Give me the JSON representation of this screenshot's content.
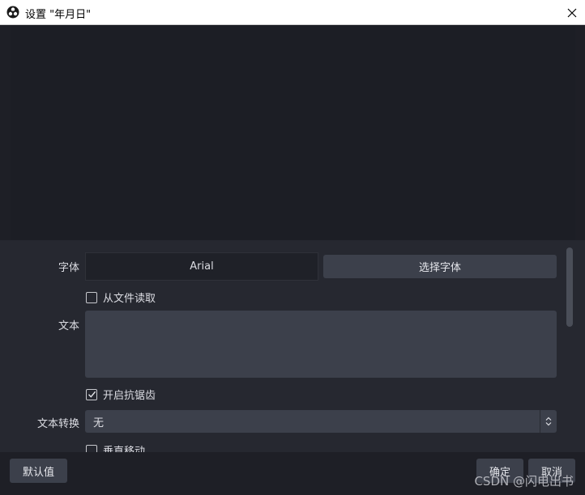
{
  "window": {
    "title": "设置 \"年月日\"",
    "close_icon": "close-icon",
    "app_icon": "obs-logo-icon"
  },
  "properties": {
    "font_label": "字体",
    "font_value": "Arial",
    "select_font_button": "选择字体",
    "read_from_file_label": "从文件读取",
    "read_from_file_checked": false,
    "text_label": "文本",
    "text_value": "",
    "antialias_label": "开启抗锯齿",
    "antialias_checked": true,
    "transform_label": "文本转换",
    "transform_value": "无",
    "vertical_label": "垂直移动",
    "vertical_checked": false
  },
  "footer": {
    "defaults_button": "默认值",
    "ok_button": "确定",
    "cancel_button": "取消"
  },
  "watermark": "CSDN @闪电出书",
  "colors": {
    "background": "#1e1f26",
    "panel": "#262830",
    "control": "#3c404b"
  }
}
